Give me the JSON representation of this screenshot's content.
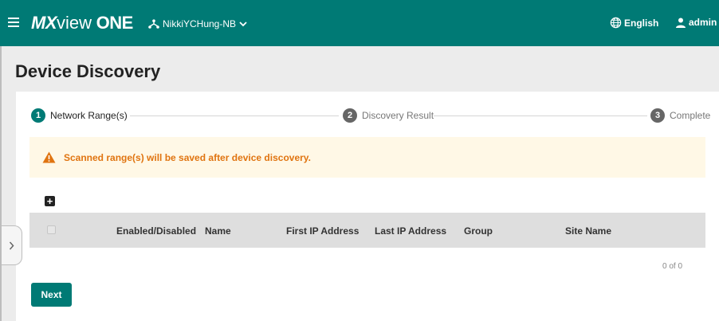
{
  "header": {
    "logo": {
      "mx": "MX",
      "view": "view",
      "one": "ONE"
    },
    "site_name": "NikkiYCHung-NB",
    "language": "English",
    "user": "admin"
  },
  "page": {
    "title": "Device Discovery"
  },
  "stepper": {
    "steps": [
      {
        "number": "1",
        "label": "Network Range(s)",
        "state": "active"
      },
      {
        "number": "2",
        "label": "Discovery Result",
        "state": "inactive"
      },
      {
        "number": "3",
        "label": "Complete",
        "state": "inactive"
      }
    ]
  },
  "warning": {
    "text": "Scanned range(s) will be saved after device discovery."
  },
  "table": {
    "columns": [
      "Enabled/Disabled",
      "Name",
      "First IP Address",
      "Last IP Address",
      "Group",
      "Site Name"
    ],
    "rows": [],
    "pager": "0 of 0"
  },
  "actions": {
    "next_label": "Next"
  },
  "colors": {
    "primary": "#007a75",
    "warning_text": "#e07410",
    "warning_bg": "#fff8e6",
    "header_bg": "#dedede"
  }
}
